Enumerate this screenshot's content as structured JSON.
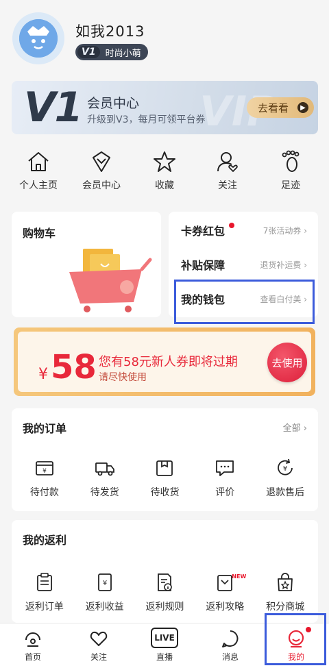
{
  "profile": {
    "username": "如我2013",
    "level": "V1",
    "level_title": "时尚小萌"
  },
  "vip": {
    "big_label": "V1",
    "watermark": "VIP",
    "title": "会员中心",
    "subtitle": "升级到V3，每月可领平台券",
    "button": "去看看"
  },
  "quick_nav": [
    {
      "label": "个人主页",
      "icon": "home-icon"
    },
    {
      "label": "会员中心",
      "icon": "diamond-heart-icon"
    },
    {
      "label": "收藏",
      "icon": "star-icon"
    },
    {
      "label": "关注",
      "icon": "user-heart-icon"
    },
    {
      "label": "足迹",
      "icon": "footprint-icon"
    }
  ],
  "cart": {
    "label": "购物车"
  },
  "wallet": {
    "rows": [
      {
        "label": "卡券红包",
        "info": "7张活动券"
      },
      {
        "label": "补贴保障",
        "info": "退货补运费"
      },
      {
        "label": "我的钱包",
        "info": "查看白付美"
      }
    ]
  },
  "coupon": {
    "currency": "¥",
    "amount": "58",
    "title": "您有58元新人券即将过期",
    "subtitle": "请尽快使用",
    "button": "去使用"
  },
  "orders": {
    "title": "我的订单",
    "all": "全部",
    "items": [
      {
        "label": "待付款",
        "icon": "wallet-yen-icon"
      },
      {
        "label": "待发货",
        "icon": "truck-icon"
      },
      {
        "label": "待收货",
        "icon": "box-icon"
      },
      {
        "label": "评价",
        "icon": "comment-icon"
      },
      {
        "label": "退款售后",
        "icon": "refund-icon"
      }
    ]
  },
  "rebates": {
    "title": "我的返利",
    "items": [
      {
        "label": "返利订单",
        "icon": "clipboard-icon"
      },
      {
        "label": "返利收益",
        "icon": "tablet-yen-icon"
      },
      {
        "label": "返利规则",
        "icon": "doc-info-icon"
      },
      {
        "label": "返利攻略",
        "icon": "book-new-icon",
        "badge": "NEW"
      },
      {
        "label": "积分商城",
        "icon": "shopping-bag-star-icon"
      }
    ]
  },
  "bottom_nav": [
    {
      "label": "首页",
      "icon": "home-circle-icon"
    },
    {
      "label": "关注",
      "icon": "heart-icon"
    },
    {
      "label": "直播",
      "icon": "live-icon",
      "badge": "LIVE"
    },
    {
      "label": "消息",
      "icon": "chat-icon"
    },
    {
      "label": "我的",
      "icon": "face-icon",
      "active": true
    }
  ],
  "colors": {
    "accent": "#e8283a",
    "highlight": "#3b5bdb",
    "vip_gold": "#e2b979"
  }
}
